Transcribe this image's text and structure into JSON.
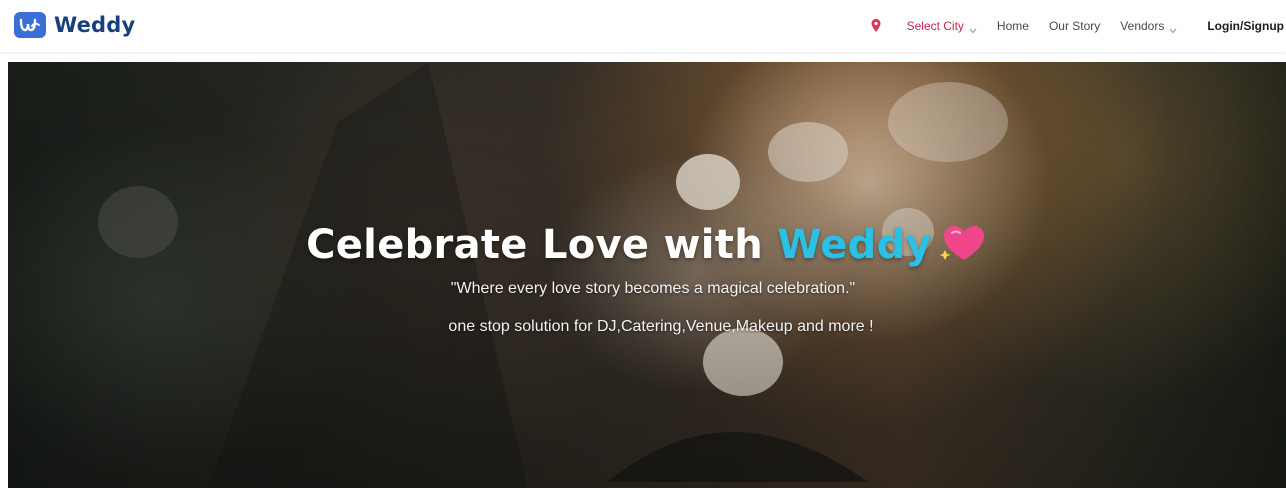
{
  "brand": {
    "name": "Weddy",
    "logo_icon": "weddy-logo-icon",
    "logo_color": "#3b6fd8"
  },
  "nav": {
    "location_icon": "map-pin-icon",
    "select_city": "Select City",
    "home": "Home",
    "our_story": "Our Story",
    "vendors": "Vendors",
    "login_signup": "Login/Signup"
  },
  "hero": {
    "title_prefix": "Celebrate Love with ",
    "title_accent": "Weddy",
    "title_icon": "sparkling-heart-icon",
    "quote": "\"Where every love story becomes a magical celebration.\"",
    "subtitle": "one stop solution for DJ,Catering,Venue,Makeup and more !"
  },
  "colors": {
    "accent": "#27c2e6",
    "city_link": "#c4284c"
  }
}
